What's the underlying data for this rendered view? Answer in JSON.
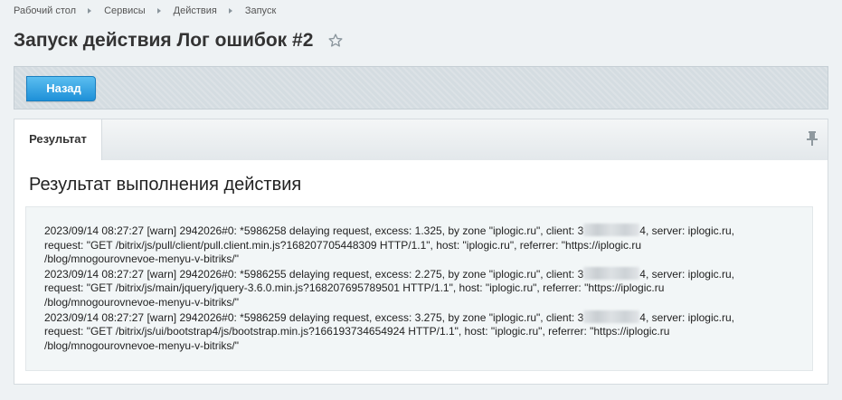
{
  "breadcrumb": {
    "items": [
      "Рабочий стол",
      "Сервисы",
      "Действия",
      "Запуск"
    ]
  },
  "page": {
    "title": "Запуск действия Лог ошибок #2",
    "favorite_icon": "star-outline-icon"
  },
  "toolbar": {
    "back_label": "Назад"
  },
  "tabs": {
    "items": [
      {
        "label": "Результат"
      }
    ],
    "pin_icon": "pin-icon"
  },
  "content": {
    "title": "Результат выполнения действия",
    "log": [
      {
        "line1_before": "2023/09/14 08:27:27 [warn] 2942026#0: *5986258 delaying request, excess: 1.325, by zone \"iplogic.ru\", client: 3",
        "line1_after": "4, server: iplogic.ru,",
        "line2": "request: \"GET /bitrix/js/pull/client/pull.client.min.js?168207705448309 HTTP/1.1\", host: \"iplogic.ru\", referrer: \"https://iplogic.ru",
        "line3": "/blog/mnogourovnevoe-menyu-v-bitriks/\""
      },
      {
        "line1_before": "2023/09/14 08:27:27 [warn] 2942026#0: *5986255 delaying request, excess: 2.275, by zone \"iplogic.ru\", client: 3",
        "line1_after": "4, server: iplogic.ru,",
        "line2": "request: \"GET /bitrix/js/main/jquery/jquery-3.6.0.min.js?168207695789501 HTTP/1.1\", host: \"iplogic.ru\", referrer: \"https://iplogic.ru",
        "line3": "/blog/mnogourovnevoe-menyu-v-bitriks/\""
      },
      {
        "line1_before": "2023/09/14 08:27:27 [warn] 2942026#0: *5986259 delaying request, excess: 3.275, by zone \"iplogic.ru\", client: 3",
        "line1_after": "4, server: iplogic.ru,",
        "line2": "request: \"GET /bitrix/js/ui/bootstrap4/js/bootstrap.min.js?166193734654924 HTTP/1.1\", host: \"iplogic.ru\", referrer: \"https://iplogic.ru",
        "line3": "/blog/mnogourovnevoe-menyu-v-bitriks/\""
      }
    ]
  },
  "colors": {
    "accent": "#2b9fe0",
    "background": "#eef2f4"
  }
}
